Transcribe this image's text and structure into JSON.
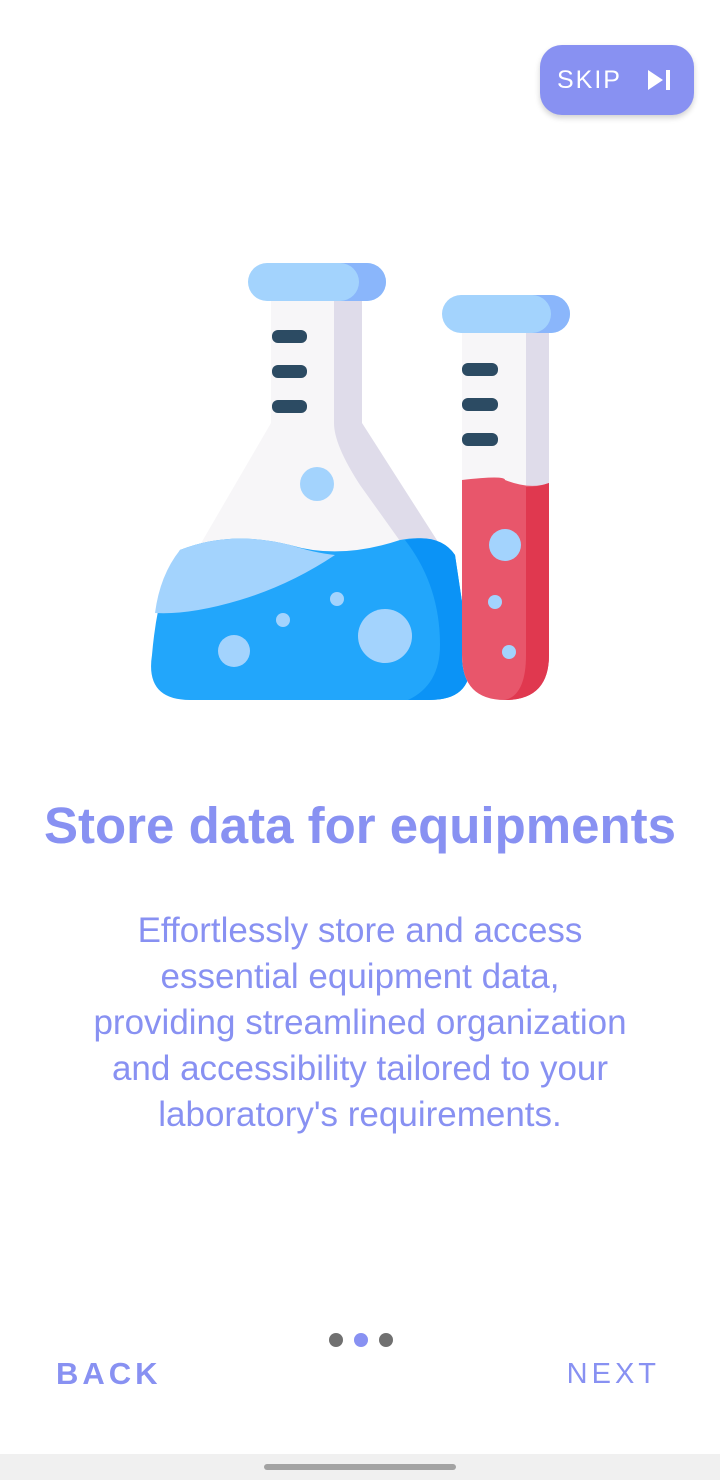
{
  "colors": {
    "accent": "#8891f2",
    "flask_liquid": "#22a6fb",
    "tube_liquid": "#e8566b",
    "cap": "#a3d3fd",
    "scale_marks": "#2c4b63"
  },
  "skip_button": {
    "label": "SKIP",
    "icon": "skip-next-icon"
  },
  "illustration": {
    "icon": "lab-flask-and-test-tube-icon"
  },
  "onboarding": {
    "title": "Store data for equipments",
    "description_lines": [
      "Effortlessly store and access",
      "essential equipment data,",
      "providing streamlined organization",
      "and accessibility tailored to your",
      "laboratory's requirements."
    ],
    "page_count": 3,
    "current_page": 2
  },
  "footer": {
    "back_label": "BACK",
    "next_label": "NEXT"
  }
}
